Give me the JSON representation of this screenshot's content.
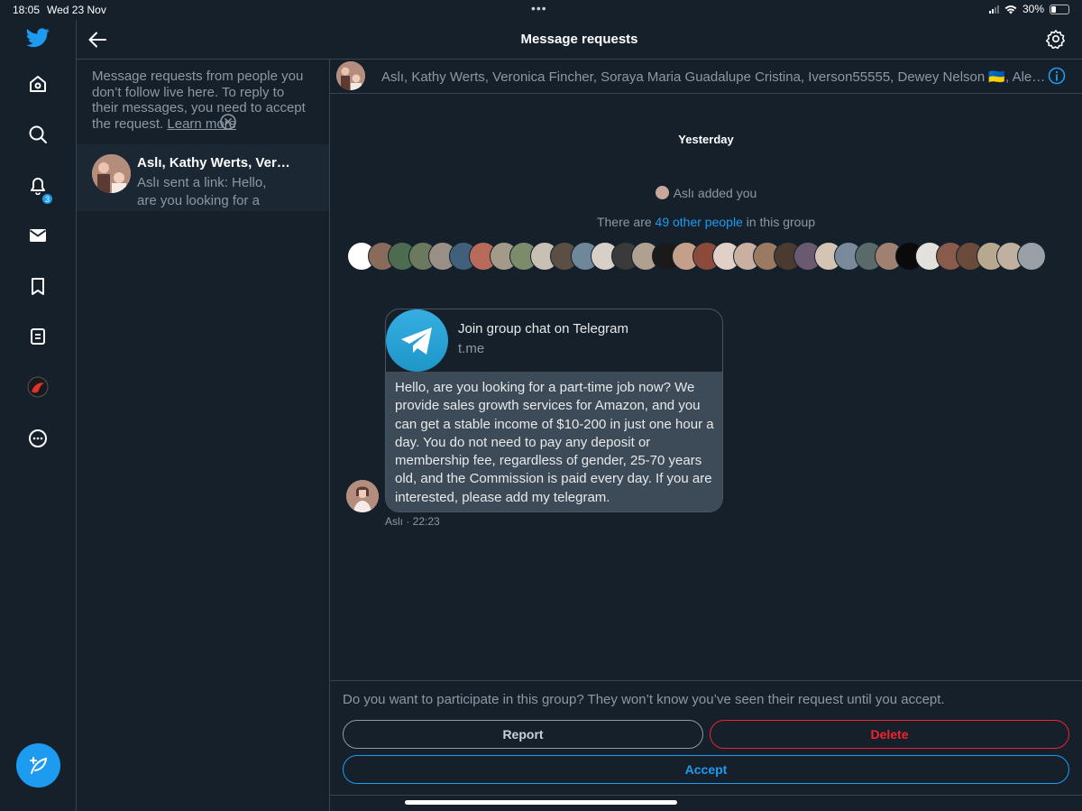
{
  "status_bar": {
    "time": "18:05",
    "date": "Wed 23 Nov",
    "battery": "30%",
    "battery_level": 0.3
  },
  "nav": {
    "items": [
      "home-icon",
      "search-icon",
      "notifications-icon",
      "messages-icon",
      "bookmarks-icon",
      "lists-icon",
      "profile-icon",
      "more-icon"
    ],
    "notification_count": "3"
  },
  "header": {
    "title": "Message requests"
  },
  "requests": {
    "info": "Message requests from people you don’t follow live here. To reply to their messages, you need to accept the request.",
    "learn_more": "Learn more",
    "items": [
      {
        "name": "Aslı, Kathy Werts, Veronica Fincher",
        "preview": "Aslı sent a link: Hello, are you looking for a"
      }
    ]
  },
  "conversation": {
    "members": "Aslı, Kathy Werts, Veronica Fincher, Soraya Maria Guadalupe Cristina, Iverson55555, Dewey Nelson 🇺🇦, Alex...",
    "day_separator": "Yesterday",
    "added_text": "Aslı added you",
    "others_prefix": "There are",
    "others_link": "49 other people",
    "others_suffix": "in this group",
    "card": {
      "title": "Join group chat on Telegram",
      "domain": "t.me",
      "body": "Hello, are you looking for a part-time job now? We provide sales growth services for Amazon, and you can get a stable income of $10-200 in just one hour a day. You do not need to pay any deposit or membership fee, regardless of gender, 25-70 years old, and the Commission is paid every day. If you are interested, please add my telegram."
    },
    "sender": "Aslı",
    "time": "· 22:23"
  },
  "footer": {
    "prompt": "Do you want to participate in this group? They won’t know you’ve seen their request until you accept.",
    "report": "Report",
    "delete": "Delete",
    "accept": "Accept"
  },
  "colors": {
    "background": "#15202b",
    "accent": "#1d9bf0",
    "danger": "#f4212e",
    "card_body": "#3d4a57"
  }
}
